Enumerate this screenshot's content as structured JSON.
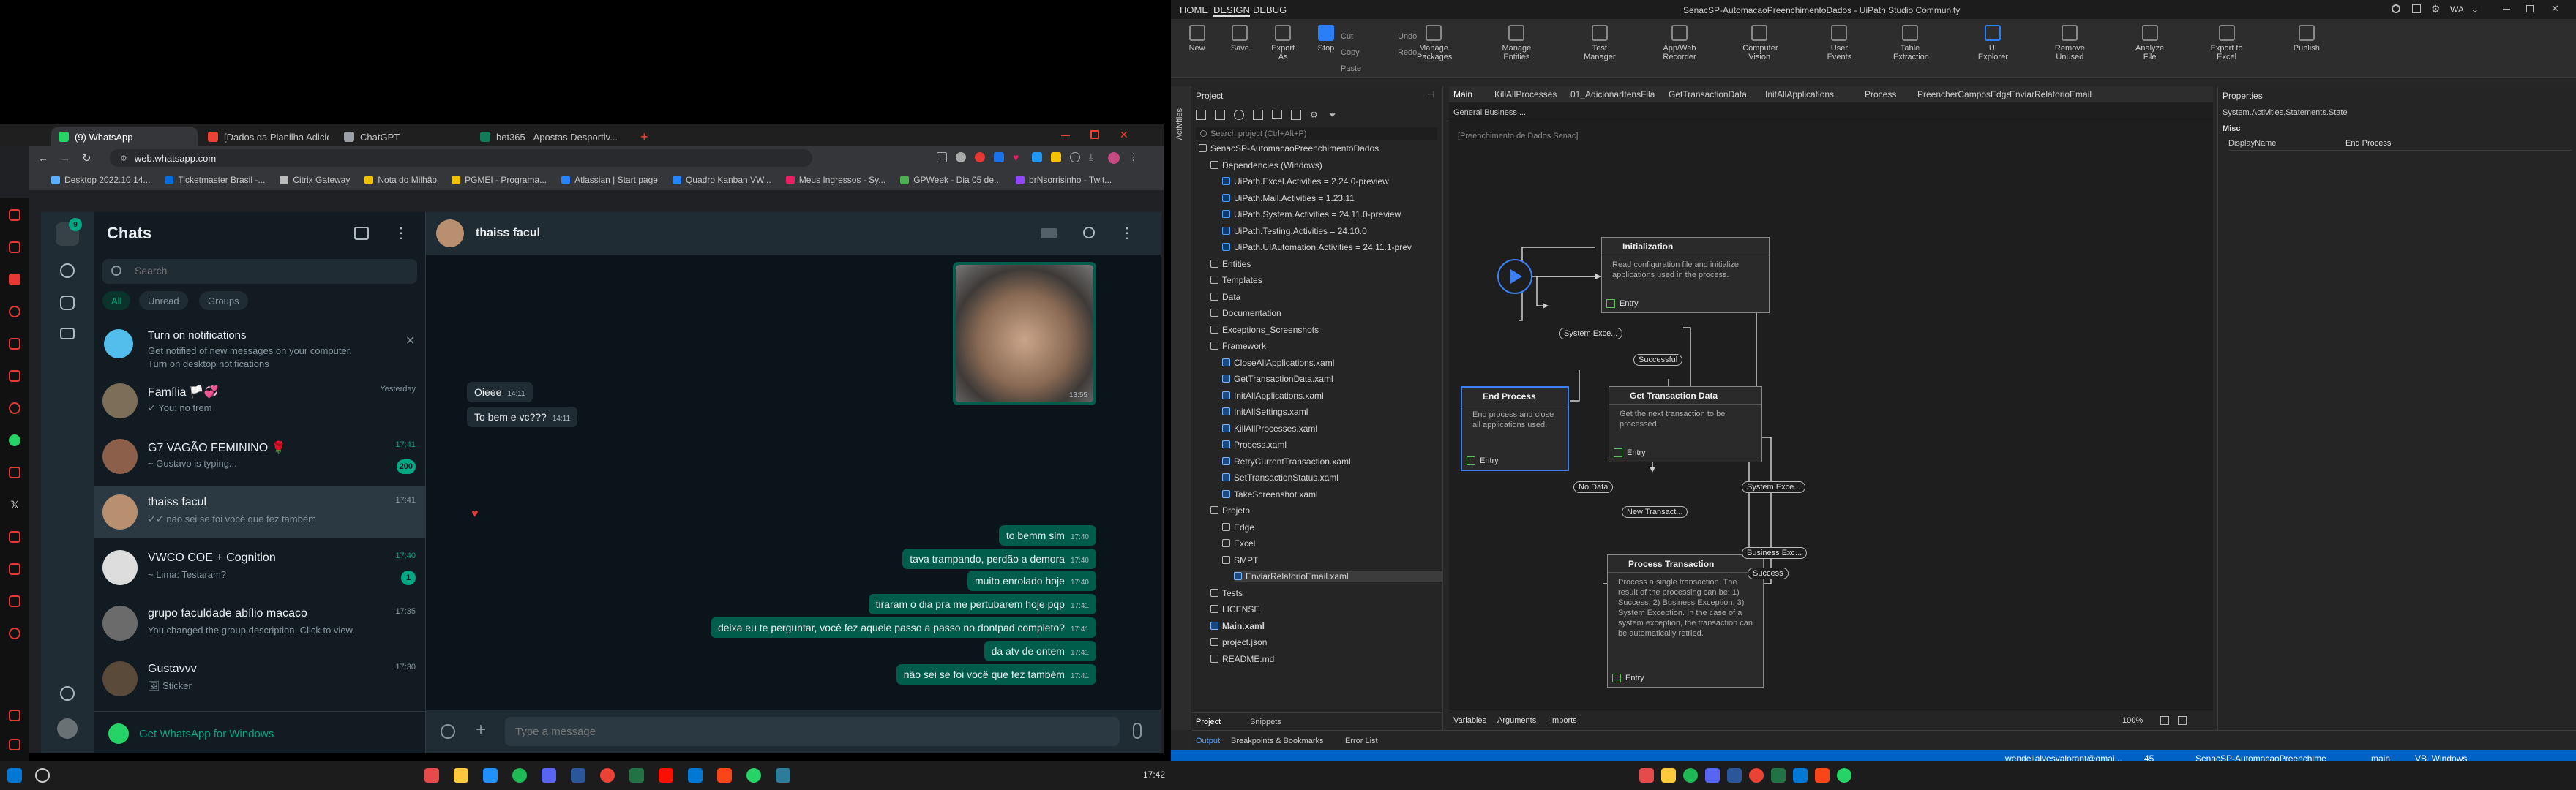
{
  "browser": {
    "tabs": [
      {
        "title": "(9) WhatsApp",
        "color": "#25d366",
        "active": true
      },
      {
        "title": "[Dados da Planilha Adicion...",
        "color": "#ea4335"
      },
      {
        "title": "ChatGPT",
        "color": "#9aa0a6"
      },
      {
        "title": "bet365 - Apostas Desportiv...",
        "color": "#137a5a"
      }
    ],
    "new_tab": "+",
    "url": "web.whatsapp.com",
    "bookmarks": [
      {
        "label": "Desktop 2022.10.14...",
        "color": "#5ab0ff"
      },
      {
        "label": "Ticketmaster Brasil -...",
        "color": "#026cdf"
      },
      {
        "label": "Citrix Gateway",
        "color": "#bbb"
      },
      {
        "label": "Nota do Milhão",
        "color": "#f2c200"
      },
      {
        "label": "PGMEI - Programa...",
        "color": "#f2c200"
      },
      {
        "label": "Atlassian | Start page",
        "color": "#2684ff"
      },
      {
        "label": "Quadro Kanban VW...",
        "color": "#2684ff"
      },
      {
        "label": "Meus Ingressos - Sy...",
        "color": "#e91e63"
      },
      {
        "label": "GPWeek - Dia 05 de...",
        "color": "#4caf50"
      },
      {
        "label": "brNsorrisinho - Twit...",
        "color": "#9146ff"
      }
    ]
  },
  "whatsapp": {
    "nav_badge": "9",
    "list_title": "Chats",
    "search_placeholder": "Search",
    "filters": [
      "All",
      "Unread",
      "Groups"
    ],
    "notification": {
      "title": "Turn on notifications",
      "text": "Get notified of new messages on your computer.",
      "link": "Turn on desktop notifications"
    },
    "chats": [
      {
        "name": "Família 🏳️💞",
        "msg": "✓ You: no trem",
        "time": "Yesterday",
        "avatar": "#7d6e5a"
      },
      {
        "name": "G7 VAGÃO FEMININO 🌹",
        "msg": "~ Gustavo is typing...",
        "time": "17:41",
        "badge": "200",
        "avatar": "#8c5f4a",
        "green": true
      },
      {
        "name": "thaiss facul",
        "msg": "✓✓ não sei se foi você que fez também",
        "time": "17:41",
        "avatar": "#b89070",
        "selected": true
      },
      {
        "name": "VWCO COE + Cognition",
        "msg": "~ Lima: Testaram?",
        "time": "17:40",
        "badge": "1",
        "avatar": "#dddddd",
        "green": true
      },
      {
        "name": "grupo faculdade abílio macaco",
        "msg": "You changed the group description. Click to view.",
        "time": "17:35",
        "avatar": "#6b6b6b"
      },
      {
        "name": "Gustavvv",
        "msg": "🖼 Sticker",
        "time": "17:30",
        "avatar": "#5a4a3a"
      }
    ],
    "get_windows": "Get WhatsApp for Windows",
    "chat": {
      "contact": "thaiss facul",
      "image_time": "13:55",
      "messages": [
        {
          "dir": "in",
          "text": "Oieee",
          "time": "14:11"
        },
        {
          "dir": "in",
          "text": "To bem e vc???",
          "time": "14:11"
        },
        {
          "dir": "out",
          "text": "to bemm sim",
          "time": "17:40"
        },
        {
          "dir": "out",
          "text": "tava trampando, perdão a demora",
          "time": "17:40"
        },
        {
          "dir": "out",
          "text": "muito enrolado hoje",
          "time": "17:40"
        },
        {
          "dir": "out",
          "text": "tiraram o dia pra me pertubarem hoje pqp",
          "time": "17:41"
        },
        {
          "dir": "out",
          "text": "deixa eu te perguntar, você fez aquele passo a passo no dontpad completo?",
          "time": "17:41"
        },
        {
          "dir": "out",
          "text": "da atv de ontem",
          "time": "17:41"
        },
        {
          "dir": "out",
          "text": "não sei se foi você que fez também",
          "time": "17:41"
        }
      ],
      "input_placeholder": "Type a message"
    }
  },
  "uipath": {
    "title": "SenacSP-AutomacaoPreenchimentoDados - UiPath Studio Community",
    "menu": [
      "HOME",
      "DESIGN",
      "DEBUG"
    ],
    "user": "WA",
    "ribbon": [
      {
        "label": "New"
      },
      {
        "label": "Save"
      },
      {
        "label": "Export As"
      },
      {
        "label": "Stop"
      },
      {
        "label": "Manage Packages"
      },
      {
        "label": "Manage Entities"
      },
      {
        "label": "Test Manager"
      },
      {
        "label": "App/Web Recorder"
      },
      {
        "label": "Computer Vision"
      },
      {
        "label": "User Events"
      },
      {
        "label": "Table Extraction"
      },
      {
        "label": "UI Explorer"
      },
      {
        "label": "Remove Unused"
      },
      {
        "label": "Analyze File"
      },
      {
        "label": "Export to Excel"
      },
      {
        "label": "Publish"
      }
    ],
    "ribbon_small": [
      "Cut",
      "Copy",
      "Paste",
      "Undo",
      "Redo"
    ],
    "project_panel": {
      "title": "Project",
      "search": "Search project (Ctrl+Alt+P)",
      "tree": [
        {
          "label": "SenacSP-AutomacaoPreenchimentoDados",
          "level": 0
        },
        {
          "label": "Dependencies (Windows)",
          "level": 1
        },
        {
          "label": "UiPath.Excel.Activities = 2.24.0-preview",
          "level": 2,
          "kind": "dep"
        },
        {
          "label": "UiPath.Mail.Activities = 1.23.11",
          "level": 2,
          "kind": "dep"
        },
        {
          "label": "UiPath.System.Activities = 24.11.0-preview",
          "level": 2,
          "kind": "dep"
        },
        {
          "label": "UiPath.Testing.Activities = 24.10.0",
          "level": 2,
          "kind": "dep"
        },
        {
          "label": "UiPath.UIAutomation.Activities = 24.11.1-prev",
          "level": 2,
          "kind": "dep"
        },
        {
          "label": "Entities",
          "level": 1
        },
        {
          "label": "Templates",
          "level": 1
        },
        {
          "label": "Data",
          "level": 1
        },
        {
          "label": "Documentation",
          "level": 1
        },
        {
          "label": "Exceptions_Screenshots",
          "level": 1
        },
        {
          "label": "Framework",
          "level": 1
        },
        {
          "label": "CloseAllApplications.xaml",
          "level": 2,
          "kind": "file"
        },
        {
          "label": "GetTransactionData.xaml",
          "level": 2,
          "kind": "file"
        },
        {
          "label": "InitAllApplications.xaml",
          "level": 2,
          "kind": "file"
        },
        {
          "label": "InitAllSettings.xaml",
          "level": 2,
          "kind": "file"
        },
        {
          "label": "KillAllProcesses.xaml",
          "level": 2,
          "kind": "file"
        },
        {
          "label": "Process.xaml",
          "level": 2,
          "kind": "file"
        },
        {
          "label": "RetryCurrentTransaction.xaml",
          "level": 2,
          "kind": "file"
        },
        {
          "label": "SetTransactionStatus.xaml",
          "level": 2,
          "kind": "file"
        },
        {
          "label": "TakeScreenshot.xaml",
          "level": 2,
          "kind": "file"
        },
        {
          "label": "Projeto",
          "level": 1
        },
        {
          "label": "Edge",
          "level": 2
        },
        {
          "label": "Excel",
          "level": 2
        },
        {
          "label": "SMPT",
          "level": 2
        },
        {
          "label": "EnviarRelatorioEmail.xaml",
          "level": 3,
          "kind": "file",
          "selected": true
        },
        {
          "label": "Tests",
          "level": 1
        },
        {
          "label": "LICENSE",
          "level": 1
        },
        {
          "label": "Main.xaml",
          "level": 1,
          "kind": "file",
          "bold": true
        },
        {
          "label": "project.json",
          "level": 1
        },
        {
          "label": "README.md",
          "level": 1
        }
      ],
      "bottom_tabs": [
        "Project",
        "Snippets"
      ]
    },
    "doc_tabs": [
      "Main",
      "KillAllProcesses",
      "01_AdicionarItensFila",
      "GetTransactionData",
      "InitAllApplications",
      "Process",
      "PreencherCamposEdge",
      "EnviarRelatorioEmail"
    ],
    "breadcrumb": "General Business ...",
    "canvas_title": "[Preenchimento de Dados Senac]",
    "states": {
      "init": {
        "title": "Initialization",
        "desc": "Read configuration file and initialize applications used in the process.",
        "entry": "Entry"
      },
      "end": {
        "title": "End Process",
        "desc": "End process and close all applications used.",
        "entry": "Entry"
      },
      "get": {
        "title": "Get Transaction Data",
        "desc": "Get the next transaction to be processed.",
        "entry": "Entry"
      },
      "proc": {
        "title": "Process Transaction",
        "desc": "Process a single transaction. The result of the processing can be: 1) Success, 2) Business Exception, 3) System Exception. In the case of a system exception, the transaction can be automatically retried.",
        "entry": "Entry"
      }
    },
    "transitions": {
      "sysexc1": "System Exce...",
      "successful": "Successful",
      "nodata": "No Data",
      "newtrans": "New Transact...",
      "sysexc2": "System Exce...",
      "busexc": "Business Exc...",
      "success": "Success"
    },
    "designer_bottom": [
      "Variables",
      "Arguments",
      "Imports"
    ],
    "zoom": "100%",
    "properties": {
      "title": "Properties",
      "type": "System.Activities.Statements.State",
      "section": "Misc",
      "prop_name": "DisplayName",
      "prop_value": "End Process"
    },
    "output_tabs": [
      "Output",
      "Breakpoints & Bookmarks",
      "Error List"
    ],
    "status": {
      "email": "wendellalvesvalorant@gmai...",
      "count": "45",
      "project": "SenacSP-AutomacaoPreenchime",
      "branch": "main",
      "profile": "VB, Windows"
    }
  },
  "taskbar": {
    "time": "17:42"
  }
}
